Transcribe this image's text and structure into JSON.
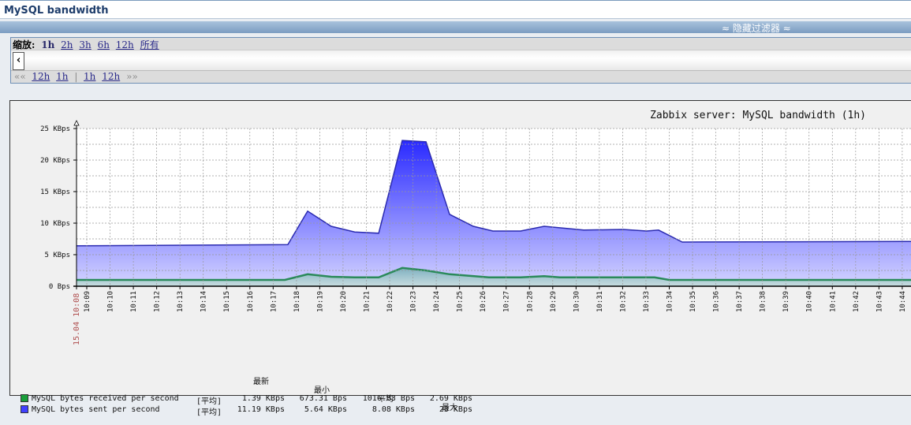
{
  "page": {
    "title": "MySQL bandwidth",
    "hide_filter": "≈ 隐藏过滤器 ≈"
  },
  "filter": {
    "zoom_label": "缩放:",
    "zoom_options": [
      "1h",
      "2h",
      "3h",
      "6h",
      "12h",
      "所有"
    ],
    "nav": {
      "back_far": "««",
      "back": [
        "12h",
        "1h"
      ],
      "sep": "|",
      "fwd": [
        "1h",
        "12h"
      ],
      "fwd_far": "»»"
    },
    "scroll_left": "‹"
  },
  "legend": {
    "headers": [
      "最新",
      "最小",
      "平均",
      "最大"
    ],
    "rows": [
      {
        "name": "MySQL bytes received per second",
        "func": "[平均]",
        "last": "1.39 KBps",
        "min": "673.31 Bps",
        "avg": "1016.83 Bps",
        "max": "2.69 KBps",
        "color": "#1a9e3a"
      },
      {
        "name": "MySQL bytes sent per second",
        "func": "[平均]",
        "last": "11.19 KBps",
        "min": "5.64 KBps",
        "avg": "8.08 KBps",
        "max": "23 KBps",
        "color": "#4040ff"
      }
    ]
  },
  "chart_data": {
    "type": "area",
    "title": "Zabbix server: MySQL bandwidth (1h)",
    "date_label": "15.04 10:08",
    "ylabel": "KBps",
    "ylim": [
      0,
      25
    ],
    "y_ticks": [
      "0 Bps",
      "5 KBps",
      "10 KBps",
      "15 KBps",
      "20 KBps",
      "25 KBps"
    ],
    "x_ticks": [
      "10:09",
      "10:10",
      "10:11",
      "10:12",
      "10:13",
      "10:14",
      "10:15",
      "10:16",
      "10:17",
      "10:18",
      "10:19",
      "10:20",
      "10:21",
      "10:22",
      "10:23",
      "10:24",
      "10:25",
      "10:26",
      "10:27",
      "10:28",
      "10:29",
      "10:30",
      "10:31",
      "10:32",
      "10:33",
      "10:34",
      "10:35",
      "10:36",
      "10:37",
      "10:38",
      "10:39",
      "10:40",
      "10:41",
      "10:42",
      "10:43",
      "10:44"
    ],
    "x_unit": "minutes after 10:00",
    "xlim": [
      8.56,
      44.37
    ],
    "series": [
      {
        "name": "MySQL bytes sent per second",
        "color": "#4040ff",
        "x": [
          8.56,
          17.63,
          18.48,
          19.49,
          20.5,
          21.53,
          22.54,
          23.56,
          24.57,
          25.59,
          26.43,
          27.62,
          28.63,
          30.33,
          32.02,
          33.03,
          33.54,
          34.56,
          44.37
        ],
        "values": [
          6.4,
          6.6,
          11.9,
          9.5,
          8.6,
          8.4,
          23.1,
          22.9,
          11.4,
          9.5,
          8.75,
          8.75,
          9.5,
          8.9,
          9.0,
          8.75,
          8.9,
          7.0,
          7.1
        ]
      },
      {
        "name": "MySQL bytes received per second",
        "color": "#1a9e3a",
        "x": [
          8.56,
          17.5,
          18.48,
          19.49,
          20.5,
          21.53,
          22.54,
          23.56,
          24.57,
          26.26,
          27.62,
          28.63,
          29.3,
          33.37,
          34.0,
          44.37
        ],
        "values": [
          1.0,
          1.0,
          1.9,
          1.5,
          1.4,
          1.4,
          2.9,
          2.5,
          1.9,
          1.4,
          1.4,
          1.6,
          1.4,
          1.4,
          1.0,
          1.0
        ]
      }
    ]
  }
}
